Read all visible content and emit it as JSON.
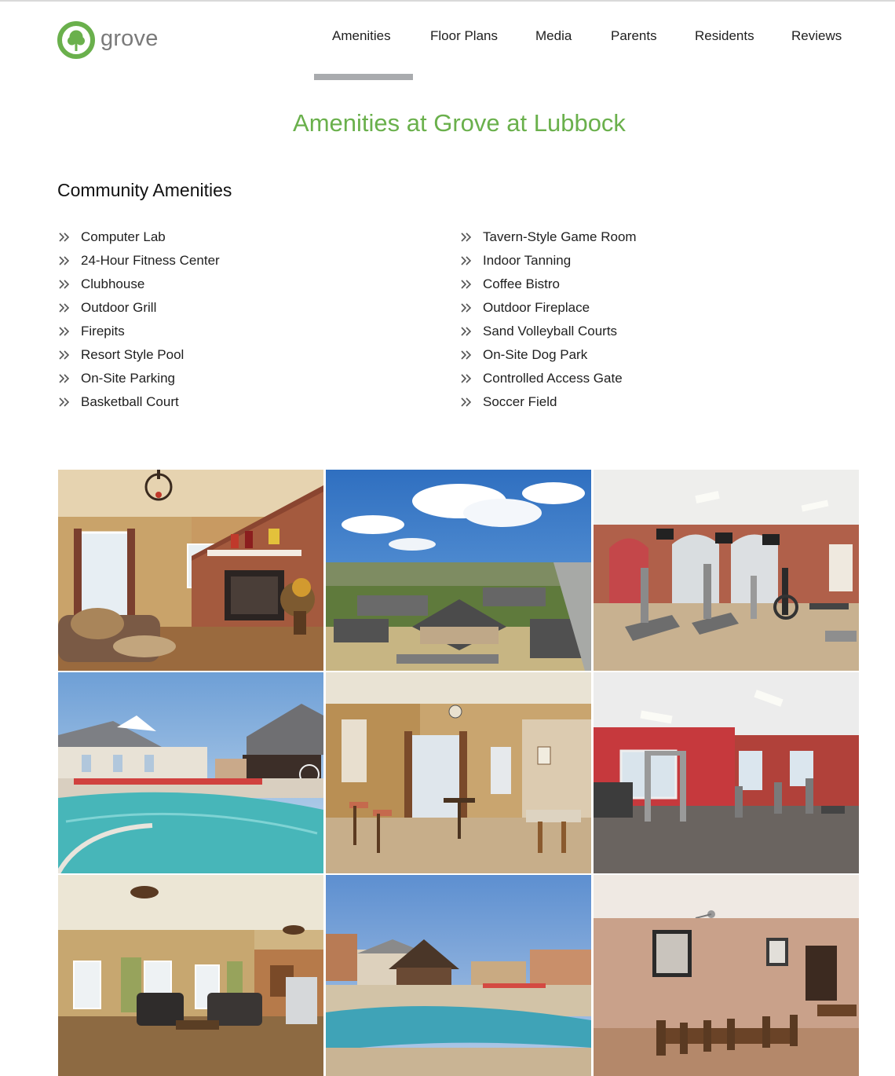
{
  "brand": {
    "name": "grove",
    "logo_color": "#6ab04c"
  },
  "nav": {
    "items": [
      "Amenities",
      "Floor Plans",
      "Media",
      "Parents",
      "Residents",
      "Reviews"
    ],
    "active": "Amenities"
  },
  "page": {
    "title": "Amenities at Grove at Lubbock"
  },
  "community": {
    "heading": "Community Amenities",
    "left": [
      "Computer Lab",
      "24-Hour Fitness Center",
      "Clubhouse",
      "Outdoor Grill",
      "Firepits",
      "Resort Style Pool",
      "On-Site Parking",
      "Basketball Court"
    ],
    "right": [
      "Tavern-Style Game Room",
      "Indoor Tanning",
      "Coffee Bistro",
      "Outdoor Fireplace",
      "Sand Volleyball Courts",
      "On-Site Dog Park",
      "Controlled Access Gate",
      "Soccer Field"
    ]
  },
  "colors": {
    "accent": "#6ab04c",
    "nav_underline": "#a9abae",
    "text": "#1f1f1f"
  }
}
